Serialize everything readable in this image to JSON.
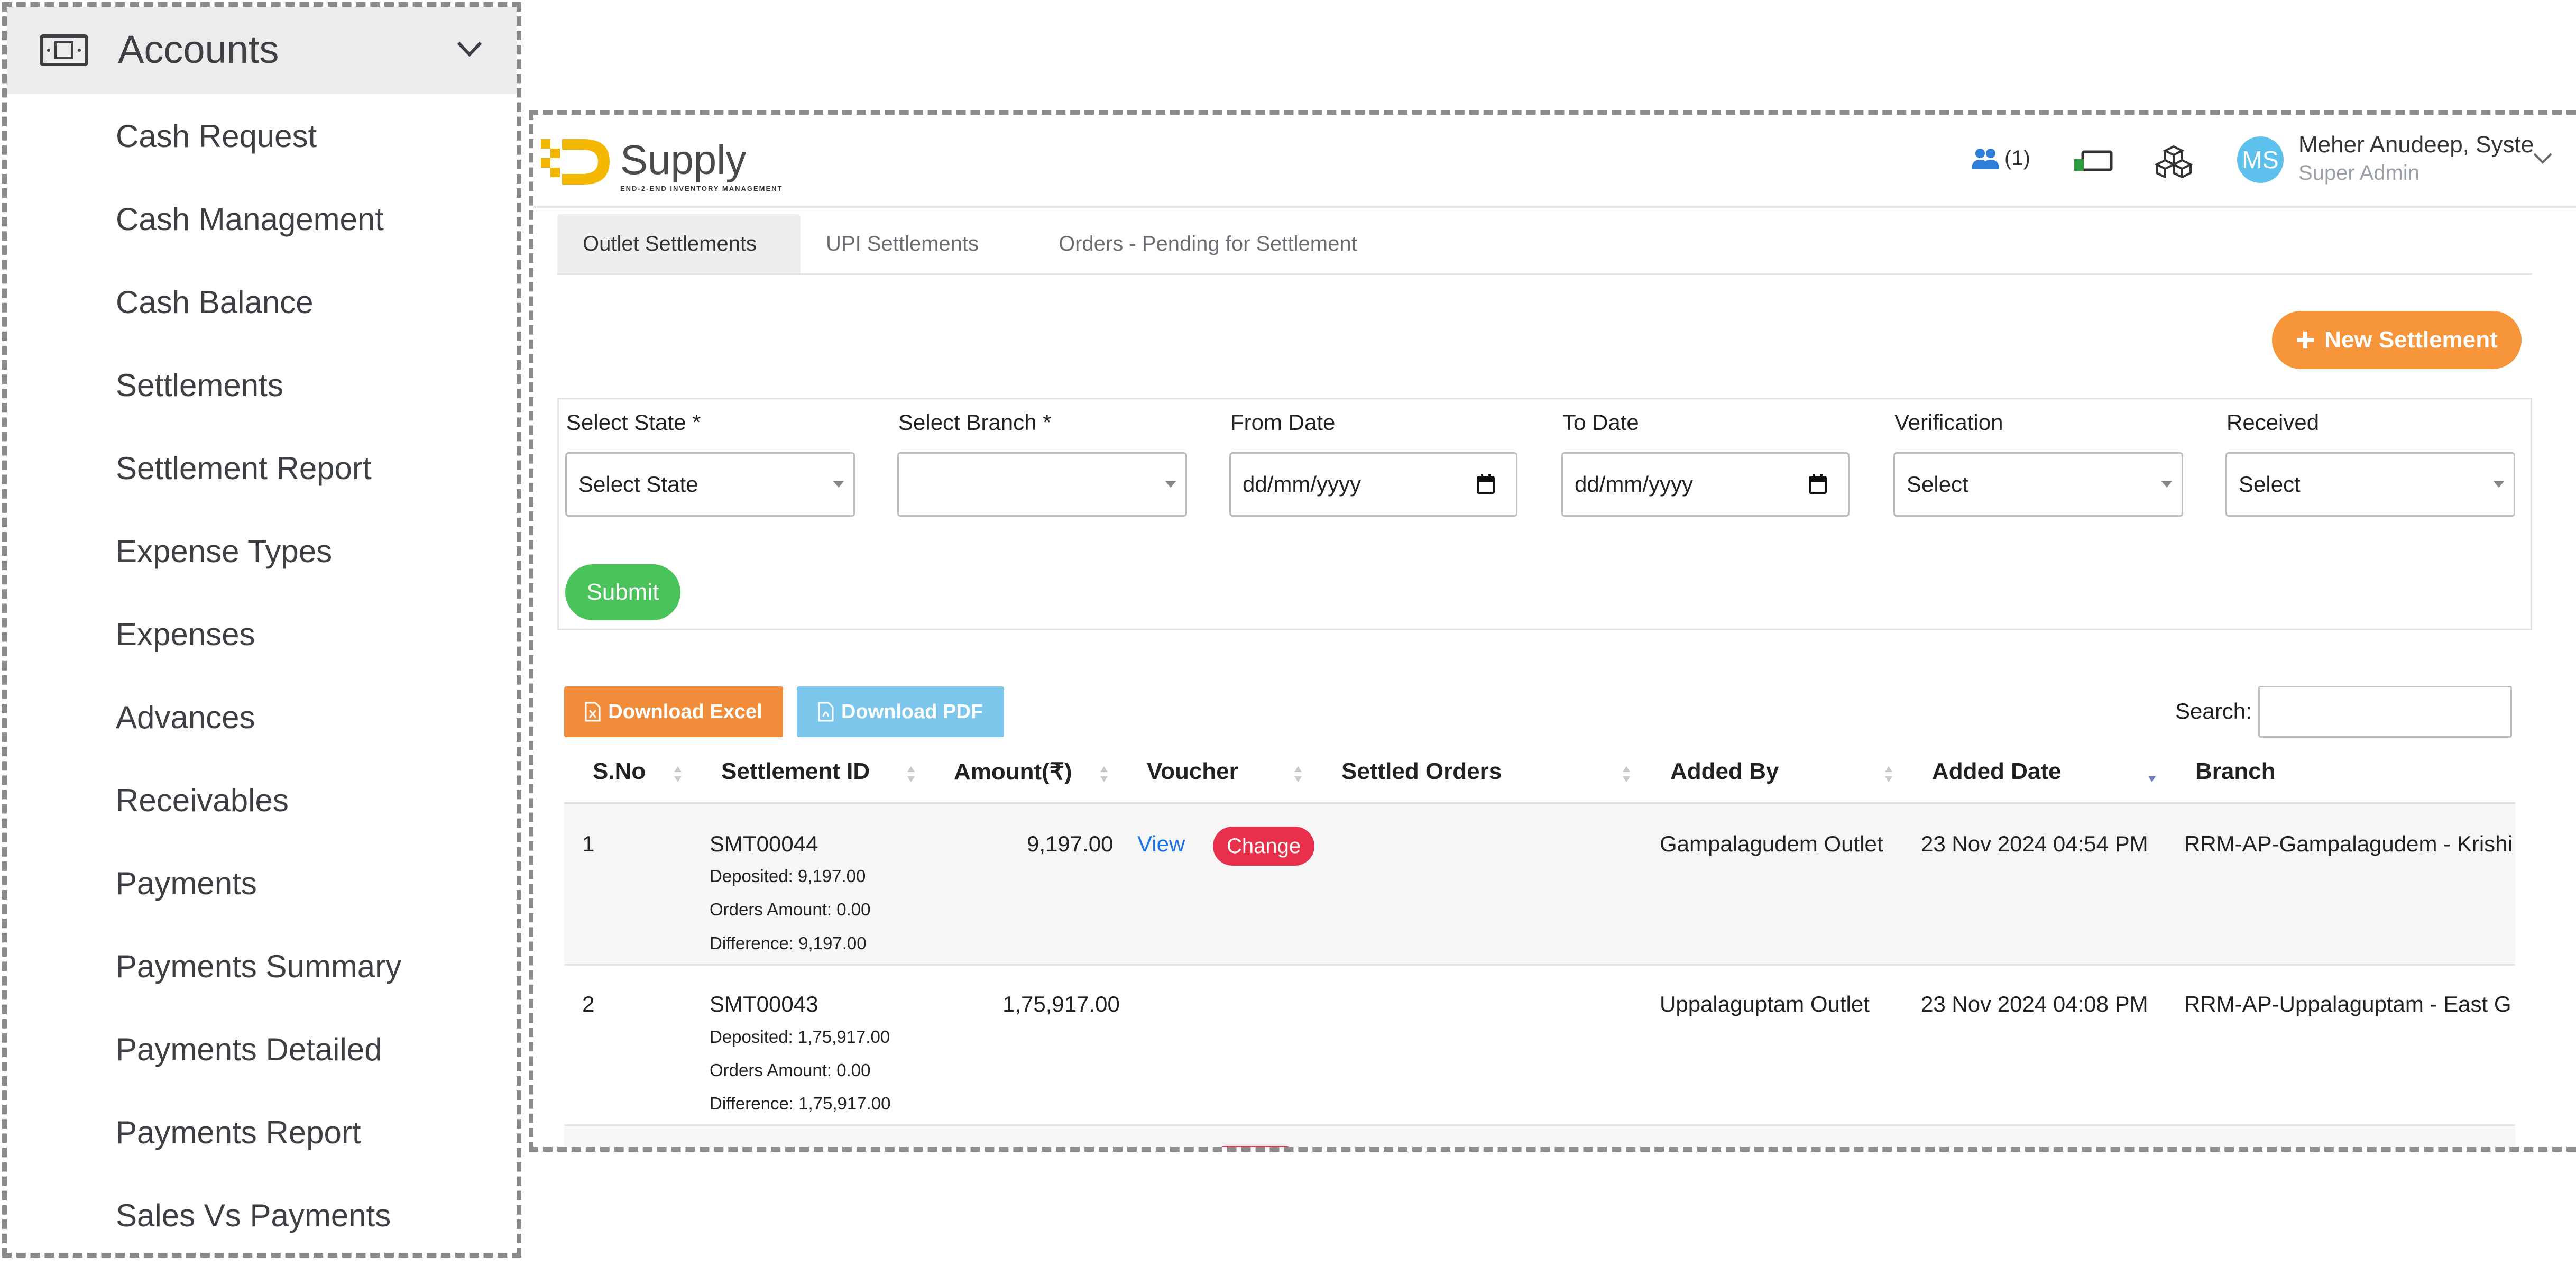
{
  "sidebar": {
    "section_title": "Accounts",
    "items": [
      {
        "label": "Cash Request"
      },
      {
        "label": "Cash Management"
      },
      {
        "label": "Cash Balance"
      },
      {
        "label": "Settlements"
      },
      {
        "label": "Settlement Report"
      },
      {
        "label": "Expense Types"
      },
      {
        "label": "Expenses"
      },
      {
        "label": "Advances"
      },
      {
        "label": "Receivables"
      },
      {
        "label": "Payments"
      },
      {
        "label": "Payments Summary"
      },
      {
        "label": "Payments Detailed"
      },
      {
        "label": "Payments Report"
      },
      {
        "label": "Sales Vs Payments"
      }
    ]
  },
  "header": {
    "logo_text": "Supply",
    "logo_tagline": "END-2-END INVENTORY MANAGEMENT",
    "users_count": "(1)",
    "avatar_initials": "MS",
    "user_name": "Meher Anudeep, Syste",
    "user_role": "Super Admin"
  },
  "tabs": [
    {
      "label": "Outlet Settlements",
      "active": true
    },
    {
      "label": "UPI Settlements",
      "active": false
    },
    {
      "label": "Orders - Pending for Settlement",
      "active": false
    }
  ],
  "new_settlement_label": "New Settlement",
  "filters": {
    "state_label": "Select State *",
    "state_value": "Select State",
    "branch_label": "Select Branch *",
    "branch_value": "",
    "from_label": "From Date",
    "from_value": "dd/mm/yyyy",
    "to_label": "To Date",
    "to_value": "dd/mm/yyyy",
    "verification_label": "Verification",
    "verification_value": "Select",
    "received_label": "Received",
    "received_value": "Select",
    "submit_label": "Submit"
  },
  "toolbar": {
    "excel_label": "Download Excel",
    "pdf_label": "Download PDF",
    "search_label": "Search:"
  },
  "table": {
    "columns": [
      "S.No",
      "Settlement ID",
      "Amount(₹)",
      "Voucher",
      "Settled Orders",
      "Added By",
      "Added Date",
      "Branch"
    ],
    "rows": [
      {
        "sno": "1",
        "id": "SMT00044",
        "deposited": "Deposited: 9,197.00",
        "orders_amount": "Orders Amount: 0.00",
        "difference": "Difference: 9,197.00",
        "amount": "9,197.00",
        "voucher_link": "View",
        "voucher_action": "Change",
        "added_by": "Gampalagudem Outlet",
        "added_date": "23 Nov 2024 04:54 PM",
        "branch": "RRM-AP-Gampalagudem - Krishi"
      },
      {
        "sno": "2",
        "id": "SMT00043",
        "deposited": "Deposited: 1,75,917.00",
        "orders_amount": "Orders Amount: 0.00",
        "difference": "Difference: 1,75,917.00",
        "amount": "1,75,917.00",
        "voucher_link": "",
        "voucher_action": "",
        "added_by": "Uppalaguptam Outlet",
        "added_date": "23 Nov 2024 04:08 PM",
        "branch": "RRM-AP-Uppalaguptam - East G"
      }
    ]
  },
  "colors": {
    "accent_orange": "#f7953a",
    "submit_green": "#49c35a",
    "change_red": "#e8304a",
    "link_blue": "#1a73e8",
    "avatar_blue": "#5ec0ec"
  }
}
